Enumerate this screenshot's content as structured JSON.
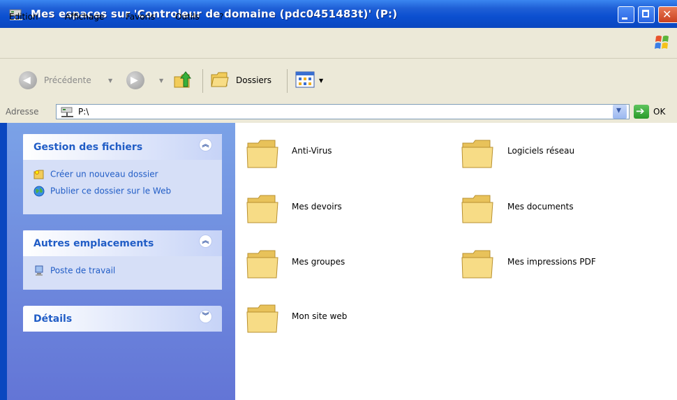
{
  "window": {
    "title": "Mes espaces sur 'Controleur de domaine (pdc0451483t)' (P:)"
  },
  "menu": {
    "items": [
      "Edition",
      "Affichage",
      "Favoris",
      "Outils",
      "?"
    ]
  },
  "toolbar": {
    "back_label": "Précédente",
    "folders_label": "Dossiers"
  },
  "address": {
    "label": "Adresse",
    "value": "P:\\",
    "go_label": "OK"
  },
  "sidebar": {
    "file_tasks": {
      "title": "Gestion des fichiers",
      "tasks": [
        "Créer un nouveau dossier",
        "Publier ce dossier sur le Web"
      ]
    },
    "other_places": {
      "title": "Autres emplacements",
      "items": [
        "Poste de travail"
      ]
    },
    "details": {
      "title": "Détails"
    }
  },
  "folders": [
    "Anti-Virus",
    "Logiciels réseau",
    "Mes devoirs",
    "Mes documents",
    "Mes groupes",
    "Mes impressions PDF",
    "Mon site web"
  ],
  "colors": {
    "titlebar": "#0a47c0",
    "link": "#215dc6",
    "chrome": "#ece9d8",
    "folder": "#f4d77a"
  }
}
